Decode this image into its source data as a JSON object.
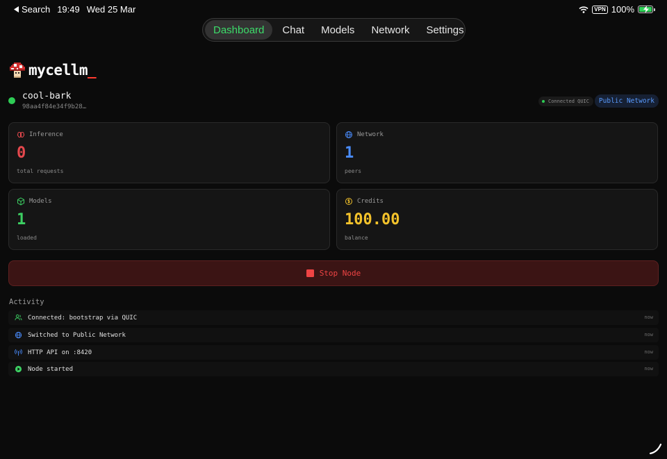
{
  "status_bar": {
    "back_label": "Search",
    "time": "19:49",
    "date": "Wed 25 Mar",
    "vpn": "VPN",
    "battery": "100%"
  },
  "nav": {
    "tabs": [
      {
        "label": "Dashboard",
        "active": true
      },
      {
        "label": "Chat",
        "active": false
      },
      {
        "label": "Models",
        "active": false
      },
      {
        "label": "Network",
        "active": false
      },
      {
        "label": "Settings",
        "active": false
      }
    ]
  },
  "header": {
    "title": "mycellm",
    "cursor": "_"
  },
  "node": {
    "name": "cool-bark",
    "id": "98aa4f84e34f9b28…",
    "connection": "Connected QUIC",
    "network": "Public Network"
  },
  "stats": {
    "inference": {
      "label": "Inference",
      "value": "0",
      "sub": "total requests",
      "color": "#e5484d"
    },
    "network": {
      "label": "Network",
      "value": "1",
      "sub": "peers",
      "color": "#4a8dff"
    },
    "models": {
      "label": "Models",
      "value": "1",
      "sub": "loaded",
      "color": "#3ccf62"
    },
    "credits": {
      "label": "Credits",
      "value": "100.00",
      "sub": "balance",
      "color": "#f3c22b"
    }
  },
  "stop_button": {
    "label": "Stop Node"
  },
  "activity": {
    "title": "Activity",
    "items": [
      {
        "text": "Connected: bootstrap via QUIC",
        "time": "now",
        "icon": "peers-icon"
      },
      {
        "text": "Switched to Public Network",
        "time": "now",
        "icon": "globe-icon"
      },
      {
        "text": "HTTP API on :8420",
        "time": "now",
        "icon": "broadcast-icon"
      },
      {
        "text": "Node started",
        "time": "now",
        "icon": "play-circle-icon"
      }
    ]
  }
}
